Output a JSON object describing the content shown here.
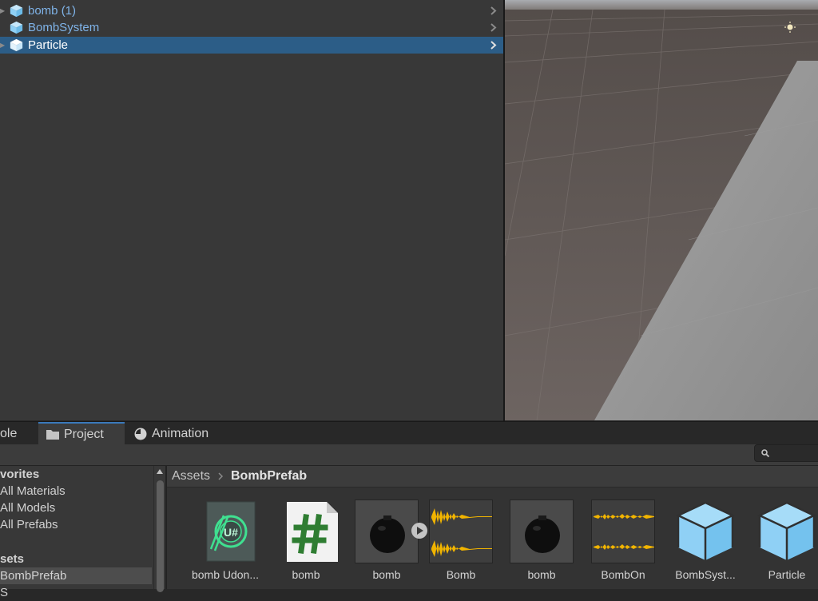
{
  "hierarchy": {
    "items": [
      {
        "label": "bomb (1)",
        "selected": false
      },
      {
        "label": "BombSystem",
        "selected": false
      },
      {
        "label": "Particle",
        "selected": true
      }
    ]
  },
  "tabs": {
    "console": "ole",
    "project": "Project",
    "animation": "Animation"
  },
  "sidebar": {
    "favorites_header": "vorites",
    "favorites": [
      "All Materials",
      "All Models",
      "All Prefabs"
    ],
    "assets_header": "sets",
    "folders": [
      {
        "label": "BombPrefab",
        "selected": true
      },
      {
        "label": "S",
        "selected": false
      }
    ]
  },
  "breadcrumb": {
    "root": "Assets",
    "current": "BombPrefab"
  },
  "assets": [
    {
      "label": "bomb Udon...",
      "icon": "udonsharp-asset-icon"
    },
    {
      "label": "bomb",
      "icon": "csharp-script-icon"
    },
    {
      "label": "bomb",
      "icon": "bomb-model-icon"
    },
    {
      "label": "Bomb",
      "icon": "audio-waveform-icon"
    },
    {
      "label": "bomb",
      "icon": "bomb-model-icon"
    },
    {
      "label": "BombOn",
      "icon": "audio-waveform-icon"
    },
    {
      "label": "BombSyst...",
      "icon": "prefab-cube-icon"
    },
    {
      "label": "Particle",
      "icon": "prefab-cube-icon"
    }
  ],
  "colors": {
    "selection": "#2c5d87",
    "prefab_text": "#7fb3e8",
    "prefab_icon": "#8fd0f5",
    "audio_wave": "#f1b400",
    "tab_accent": "#3a79bb"
  }
}
